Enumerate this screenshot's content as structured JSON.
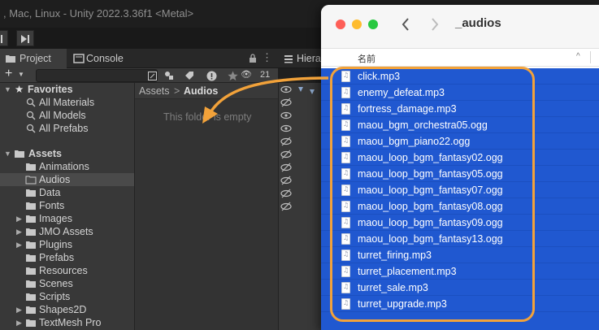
{
  "unity": {
    "window_title": ", Mac, Linux - Unity 2022.3.36f1 <Metal>",
    "tabs": {
      "project": "Project",
      "console": "Console",
      "hierarchy": "Hiera"
    },
    "toolbar": {
      "add_label": "+",
      "layer_count": "21"
    },
    "favorites": {
      "label": "Favorites",
      "items": [
        "All Materials",
        "All Models",
        "All Prefabs"
      ]
    },
    "assets": {
      "label": "Assets",
      "folders": [
        {
          "name": "Animations",
          "expandable": false
        },
        {
          "name": "Audios",
          "expandable": false,
          "selected": true
        },
        {
          "name": "Data",
          "expandable": false
        },
        {
          "name": "Fonts",
          "expandable": false
        },
        {
          "name": "Images",
          "expandable": true
        },
        {
          "name": "JMO Assets",
          "expandable": true
        },
        {
          "name": "Plugins",
          "expandable": true
        },
        {
          "name": "Prefabs",
          "expandable": false
        },
        {
          "name": "Resources",
          "expandable": false
        },
        {
          "name": "Scenes",
          "expandable": false
        },
        {
          "name": "Scripts",
          "expandable": false
        },
        {
          "name": "Shapes2D",
          "expandable": true
        },
        {
          "name": "TextMesh Pro",
          "expandable": true
        }
      ]
    },
    "breadcrumb": {
      "root": "Assets",
      "separator": ">",
      "current": "Audios"
    },
    "empty_message": "This folder is empty"
  },
  "finder": {
    "title": "_audios",
    "column_name": "名前",
    "files": [
      "click.mp3",
      "enemy_defeat.mp3",
      "fortress_damage.mp3",
      "maou_bgm_orchestra05.ogg",
      "maou_bgm_piano22.ogg",
      "maou_loop_bgm_fantasy02.ogg",
      "maou_loop_bgm_fantasy05.ogg",
      "maou_loop_bgm_fantasy07.ogg",
      "maou_loop_bgm_fantasy08.ogg",
      "maou_loop_bgm_fantasy09.ogg",
      "maou_loop_bgm_fantasy13.ogg",
      "turret_firing.mp3",
      "turret_placement.mp3",
      "turret_sale.mp3",
      "turret_upgrade.mp3"
    ]
  },
  "colors": {
    "selection_blue": "#2058d0",
    "highlight_orange": "#f2a23a",
    "unity_panel": "#383838"
  }
}
